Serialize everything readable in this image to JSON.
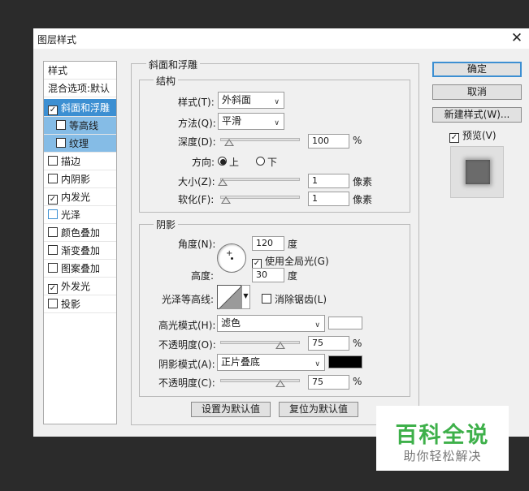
{
  "window": {
    "title": "图层样式",
    "close_glyph": "✕"
  },
  "style_list": {
    "header": "样式",
    "blend_options": "混合选项:默认",
    "items": [
      {
        "label": "斜面和浮雕",
        "checked": true,
        "state": "selected"
      },
      {
        "label": "等高线",
        "checked": false,
        "state": "sub"
      },
      {
        "label": "纹理",
        "checked": false,
        "state": "sub"
      },
      {
        "label": "描边",
        "checked": false,
        "state": "normal"
      },
      {
        "label": "内阴影",
        "checked": false,
        "state": "normal"
      },
      {
        "label": "内发光",
        "checked": true,
        "state": "normal"
      },
      {
        "label": "光泽",
        "checked": false,
        "state": "normal"
      },
      {
        "label": "颜色叠加",
        "checked": false,
        "state": "normal"
      },
      {
        "label": "渐变叠加",
        "checked": false,
        "state": "normal"
      },
      {
        "label": "图案叠加",
        "checked": false,
        "state": "normal"
      },
      {
        "label": "外发光",
        "checked": true,
        "state": "normal"
      },
      {
        "label": "投影",
        "checked": false,
        "state": "normal"
      }
    ]
  },
  "bevel": {
    "title": "斜面和浮雕",
    "structure": {
      "title": "结构",
      "style_label": "样式(T):",
      "style_value": "外斜面",
      "technique_label": "方法(Q):",
      "technique_value": "平滑",
      "depth_label": "深度(D):",
      "depth_value": "100",
      "depth_unit": "%",
      "direction_label": "方向:",
      "direction_up": "上",
      "direction_down": "下",
      "direction_selected": "上",
      "size_label": "大小(Z):",
      "size_value": "1",
      "size_unit": "像素",
      "soften_label": "软化(F):",
      "soften_value": "1",
      "soften_unit": "像素"
    },
    "shading": {
      "title": "阴影",
      "angle_label": "角度(N):",
      "angle_value": "120",
      "angle_unit": "度",
      "global_light_label": "使用全局光(G)",
      "global_light_checked": true,
      "altitude_label": "高度:",
      "altitude_value": "30",
      "altitude_unit": "度",
      "gloss_contour_label": "光泽等高线:",
      "anti_alias_label": "消除锯齿(L)",
      "anti_alias_checked": false,
      "highlight_mode_label": "高光模式(H):",
      "highlight_mode_value": "滤色",
      "highlight_color": "#ffffff",
      "highlight_opacity_label": "不透明度(O):",
      "highlight_opacity_value": "75",
      "highlight_opacity_unit": "%",
      "shadow_mode_label": "阴影模式(A):",
      "shadow_mode_value": "正片叠底",
      "shadow_color": "#000000",
      "shadow_opacity_label": "不透明度(C):",
      "shadow_opacity_value": "75",
      "shadow_opacity_unit": "%"
    },
    "make_default": "设置为默认值",
    "reset_default": "复位为默认值"
  },
  "buttons": {
    "ok": "确定",
    "cancel": "取消",
    "new_style": "新建样式(W)...",
    "preview_label": "预览(V)",
    "preview_checked": true
  },
  "watermark": {
    "title": "百科全说",
    "subtitle": "助你轻松解决"
  },
  "colors": {
    "selection": "#3c8fd2",
    "sub_selection": "#85bce6",
    "dialog_bg": "#f0f0f0",
    "backdrop": "#2b2b2b",
    "watermark_green": "#3eb04a"
  }
}
